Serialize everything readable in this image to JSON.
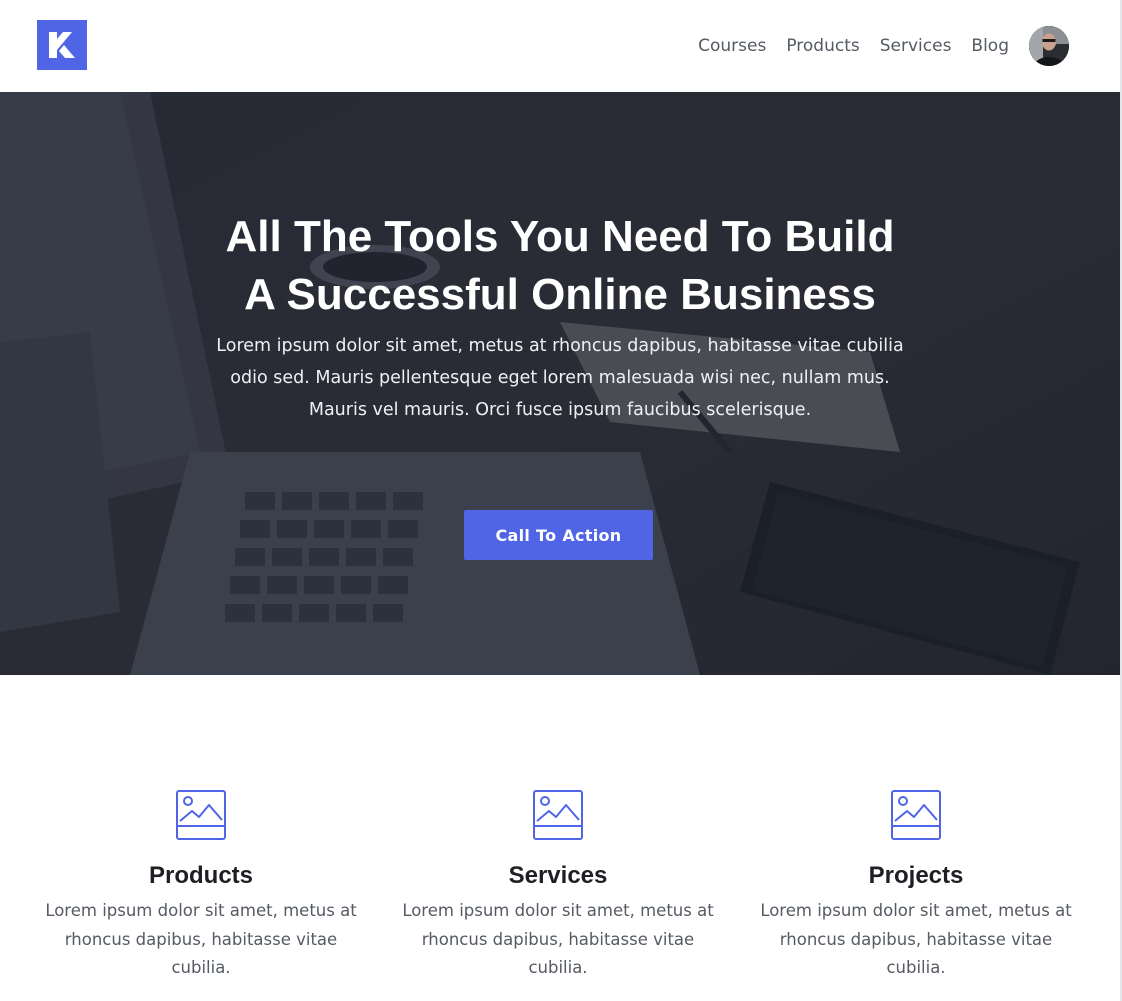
{
  "colors": {
    "accent": "#5065e6",
    "hero_overlay": "#1e2230",
    "heading": "#1d1f24",
    "body_text": "#555a63"
  },
  "header": {
    "logo_icon": "k-logo-icon",
    "nav": [
      {
        "label": "Courses"
      },
      {
        "label": "Products"
      },
      {
        "label": "Services"
      },
      {
        "label": "Blog"
      }
    ],
    "avatar_icon": "user-avatar"
  },
  "hero": {
    "title_line1": "All The Tools You Need To Build",
    "title_line2": "A Successful Online Business",
    "text": "Lorem ipsum dolor sit amet, metus at rhoncus dapibus, habitasse vitae cubilia odio sed. Mauris pellentesque eget lorem malesuada wisi nec, nullam mus. Mauris vel mauris. Orci fusce ipsum faucibus scelerisque.",
    "cta_label": "Call To Action",
    "background": "laptop-desk-photo"
  },
  "features": [
    {
      "icon": "image-icon",
      "title": "Products",
      "text": "Lorem ipsum dolor sit amet, metus at rhoncus dapibus, habitasse vitae cubilia."
    },
    {
      "icon": "image-icon",
      "title": "Services",
      "text": "Lorem ipsum dolor sit amet, metus at rhoncus dapibus, habitasse vitae cubilia."
    },
    {
      "icon": "image-icon",
      "title": "Projects",
      "text": "Lorem ipsum dolor sit amet, metus at rhoncus dapibus, habitasse vitae cubilia."
    }
  ]
}
